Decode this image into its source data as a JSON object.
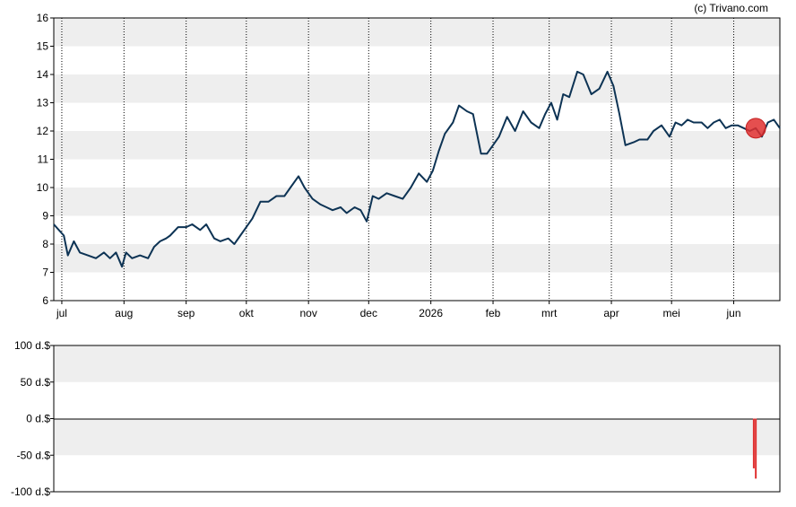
{
  "credit": "(c) Trivano.com",
  "colors": {
    "band": "#eeeeee",
    "price_line": "#0d3354",
    "marker": "#e03030",
    "volume_bar": "#e03030",
    "axis": "#000000"
  },
  "chart_data": [
    {
      "type": "line",
      "title": "",
      "xlabel": "",
      "ylabel": "",
      "ylim": [
        6,
        16
      ],
      "y_ticks": [
        "6",
        "7",
        "8",
        "9",
        "10",
        "11",
        "12",
        "13",
        "14",
        "15",
        "16"
      ],
      "grid": "alternating horizontal bands, dotted vertical month lines",
      "x_ticks": [
        "jul",
        "aug",
        "sep",
        "okt",
        "nov",
        "dec",
        "2026",
        "feb",
        "mrt",
        "apr",
        "mei",
        "jun"
      ],
      "x_tick_dates": [
        "2025-07-01",
        "2025-08-01",
        "2025-09-01",
        "2025-10-01",
        "2025-11-01",
        "2025-12-01",
        "2026-01-01",
        "2026-02-01",
        "2026-03-01",
        "2026-04-01",
        "2026-05-01",
        "2026-06-01"
      ],
      "x_range": [
        "2025-06-27",
        "2026-06-24"
      ],
      "series": [
        {
          "x": [
            "2025-06-27",
            "2025-07-02",
            "2025-07-04",
            "2025-07-07",
            "2025-07-10",
            "2025-07-14",
            "2025-07-18",
            "2025-07-22",
            "2025-07-25",
            "2025-07-28",
            "2025-07-31",
            "2025-08-02",
            "2025-08-05",
            "2025-08-09",
            "2025-08-13",
            "2025-08-16",
            "2025-08-19",
            "2025-08-22",
            "2025-08-24",
            "2025-08-28",
            "2025-09-01",
            "2025-09-04",
            "2025-09-08",
            "2025-09-11",
            "2025-09-15",
            "2025-09-18",
            "2025-09-22",
            "2025-09-25",
            "2025-09-28",
            "2025-10-01",
            "2025-10-04",
            "2025-10-08",
            "2025-10-12",
            "2025-10-16",
            "2025-10-20",
            "2025-10-23",
            "2025-10-27",
            "2025-10-30",
            "2025-11-03",
            "2025-11-07",
            "2025-11-10",
            "2025-11-13",
            "2025-11-17",
            "2025-11-20",
            "2025-11-24",
            "2025-11-27",
            "2025-11-30",
            "2025-12-03",
            "2025-12-06",
            "2025-12-10",
            "2025-12-14",
            "2025-12-18",
            "2025-12-22",
            "2025-12-26",
            "2025-12-30",
            "2026-01-02",
            "2026-01-05",
            "2026-01-08",
            "2026-01-12",
            "2026-01-15",
            "2026-01-19",
            "2026-01-22",
            "2026-01-26",
            "2026-01-29",
            "2026-02-01",
            "2026-02-04",
            "2026-02-08",
            "2026-02-12",
            "2026-02-16",
            "2026-02-20",
            "2026-02-24",
            "2026-02-27",
            "2026-03-02",
            "2026-03-05",
            "2026-03-08",
            "2026-03-11",
            "2026-03-15",
            "2026-03-18",
            "2026-03-22",
            "2026-03-26",
            "2026-03-30",
            "2026-04-02",
            "2026-04-05",
            "2026-04-08",
            "2026-04-12",
            "2026-04-15",
            "2026-04-19",
            "2026-04-22",
            "2026-04-26",
            "2026-04-30",
            "2026-05-03",
            "2026-05-06",
            "2026-05-09",
            "2026-05-12",
            "2026-05-16",
            "2026-05-19",
            "2026-05-22",
            "2026-05-25",
            "2026-05-28",
            "2026-05-31",
            "2026-06-03",
            "2026-06-06",
            "2026-06-09",
            "2026-06-12",
            "2026-06-15",
            "2026-06-18",
            "2026-06-21",
            "2026-06-24"
          ],
          "y": [
            8.7,
            8.3,
            7.6,
            8.1,
            7.7,
            7.6,
            7.5,
            7.7,
            7.5,
            7.7,
            7.2,
            7.7,
            7.5,
            7.6,
            7.5,
            7.9,
            8.1,
            8.2,
            8.3,
            8.6,
            8.6,
            8.7,
            8.5,
            8.7,
            8.2,
            8.1,
            8.2,
            8.0,
            8.3,
            8.6,
            8.9,
            9.5,
            9.5,
            9.7,
            9.7,
            10.0,
            10.4,
            10.0,
            9.6,
            9.4,
            9.3,
            9.2,
            9.3,
            9.1,
            9.3,
            9.2,
            8.8,
            9.7,
            9.6,
            9.8,
            9.7,
            9.6,
            10.0,
            10.5,
            10.2,
            10.6,
            11.3,
            11.9,
            12.3,
            12.9,
            12.7,
            12.6,
            11.2,
            11.2,
            11.5,
            11.8,
            12.5,
            12.0,
            12.7,
            12.3,
            12.1,
            12.6,
            13.0,
            12.4,
            13.3,
            13.2,
            14.1,
            14.0,
            13.3,
            13.5,
            14.1,
            13.6,
            12.6,
            11.5,
            11.6,
            11.7,
            11.7,
            12.0,
            12.2,
            11.8,
            12.3,
            12.2,
            12.4,
            12.3,
            12.3,
            12.1,
            12.3,
            12.4,
            12.1,
            12.2,
            12.2,
            12.1,
            12.0,
            12.1,
            11.8,
            12.3,
            12.4,
            12.1
          ]
        }
      ],
      "markers": [
        {
          "x": "2026-06-12",
          "y": 12.1
        }
      ]
    },
    {
      "type": "bar",
      "title": "",
      "xlabel": "",
      "ylabel": "",
      "ylim": [
        -100,
        100
      ],
      "y_ticks": [
        "100 d.$",
        "50 d.$",
        "0 d.$",
        "-50 d.$",
        "-100 d.$"
      ],
      "x_range": [
        "2026-06-27",
        "2026-06-24"
      ],
      "bars": [
        {
          "x": "2026-06-11",
          "value": -68
        },
        {
          "x": "2026-06-12",
          "value": -82
        }
      ]
    }
  ]
}
